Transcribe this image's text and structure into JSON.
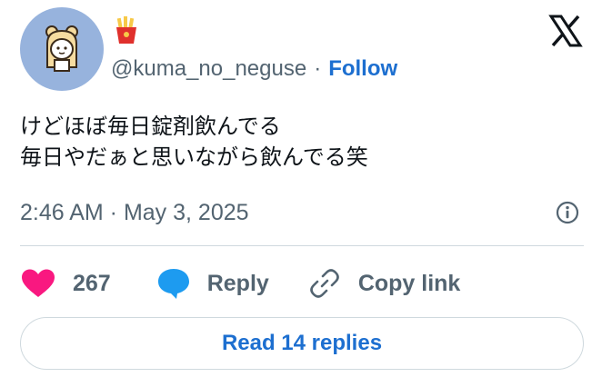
{
  "author": {
    "handle": "@kuma_no_neguse",
    "separator": "·",
    "follow_label": "Follow",
    "name_emoji": "french-fries-emoji",
    "avatar": "bear-girl-avatar"
  },
  "platform_logo": "x-logo",
  "tweet": {
    "lines": [
      "けどほぼ毎日錠剤飲んでる",
      "毎日やだぁと思いながら飲んでる笑"
    ]
  },
  "meta": {
    "timestamp": "2:46 AM · May 3, 2025",
    "info_icon": "info-icon"
  },
  "actions": {
    "likes_count": "267",
    "reply_label": "Reply",
    "copy_label": "Copy link"
  },
  "read_replies_label": "Read 14 replies",
  "colors": {
    "accent": "#1d6fd0",
    "like": "#f91880",
    "reply": "#1d9bf0",
    "muted": "#536471",
    "avatar_bg": "#97b3dd"
  }
}
